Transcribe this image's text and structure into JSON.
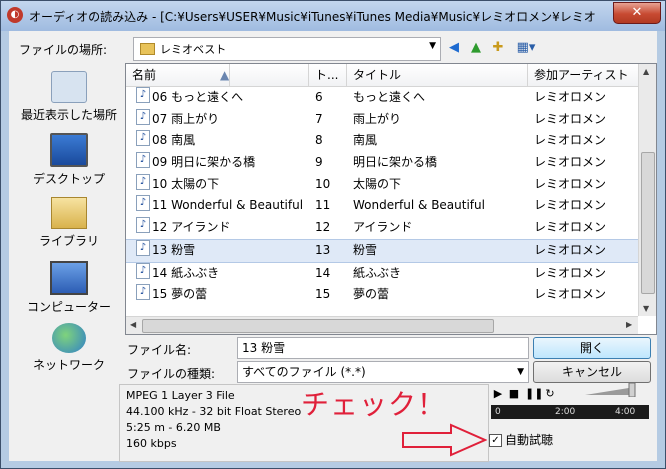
{
  "window": {
    "title": "オーディオの読み込み - [C:¥Users¥USER¥Music¥iTunes¥iTunes Media¥Music¥レミオロメン¥レミオ",
    "close_label": "✕"
  },
  "location": {
    "label": "ファイルの場所:",
    "value": "レミオベスト"
  },
  "places": [
    {
      "label": "最近表示した場所",
      "icon": "recent-places-icon"
    },
    {
      "label": "デスクトップ",
      "icon": "desktop-icon"
    },
    {
      "label": "ライブラリ",
      "icon": "library-icon"
    },
    {
      "label": "コンピューター",
      "icon": "computer-icon"
    },
    {
      "label": "ネットワーク",
      "icon": "network-icon"
    }
  ],
  "columns": [
    "名前",
    "ト...",
    "タイトル",
    "参加アーティスト"
  ],
  "files": [
    {
      "name": "06 もっと遠くへ",
      "track": "6",
      "title": "もっと遠くへ",
      "artist": "レミオロメン",
      "selected": false
    },
    {
      "name": "07 雨上がり",
      "track": "7",
      "title": "雨上がり",
      "artist": "レミオロメン",
      "selected": false
    },
    {
      "name": "08 南風",
      "track": "8",
      "title": "南風",
      "artist": "レミオロメン",
      "selected": false
    },
    {
      "name": "09 明日に架かる橋",
      "track": "9",
      "title": "明日に架かる橋",
      "artist": "レミオロメン",
      "selected": false
    },
    {
      "name": "10 太陽の下",
      "track": "10",
      "title": "太陽の下",
      "artist": "レミオロメン",
      "selected": false
    },
    {
      "name": "11 Wonderful & Beautiful",
      "track": "11",
      "title": "Wonderful & Beautiful",
      "artist": "レミオロメン",
      "selected": false
    },
    {
      "name": "12 アイランド",
      "track": "12",
      "title": "アイランド",
      "artist": "レミオロメン",
      "selected": false
    },
    {
      "name": "13 粉雪",
      "track": "13",
      "title": "粉雪",
      "artist": "レミオロメン",
      "selected": true
    },
    {
      "name": "14 紙ふぶき",
      "track": "14",
      "title": "紙ふぶき",
      "artist": "レミオロメン",
      "selected": false
    },
    {
      "name": "15 夢の蕾",
      "track": "15",
      "title": "夢の蕾",
      "artist": "レミオロメン",
      "selected": false
    }
  ],
  "filename": {
    "label": "ファイル名:",
    "value": "13 粉雪"
  },
  "filetype": {
    "label": "ファイルの種類:",
    "value": "すべてのファイル (*.*)"
  },
  "buttons": {
    "open": "開く",
    "cancel": "キャンセル"
  },
  "info": {
    "line1": "MPEG 1 Layer 3 File",
    "line2": "44.100 kHz - 32 bit Float Stereo",
    "line3": "5:25 m - 6.20 MB",
    "line4": "160 kbps"
  },
  "annotation": "チェック！",
  "player": {
    "timeline_ticks": [
      "0",
      "2:00",
      "4:00"
    ]
  },
  "autoplay": {
    "label": "自動試聴",
    "checked": true
  }
}
